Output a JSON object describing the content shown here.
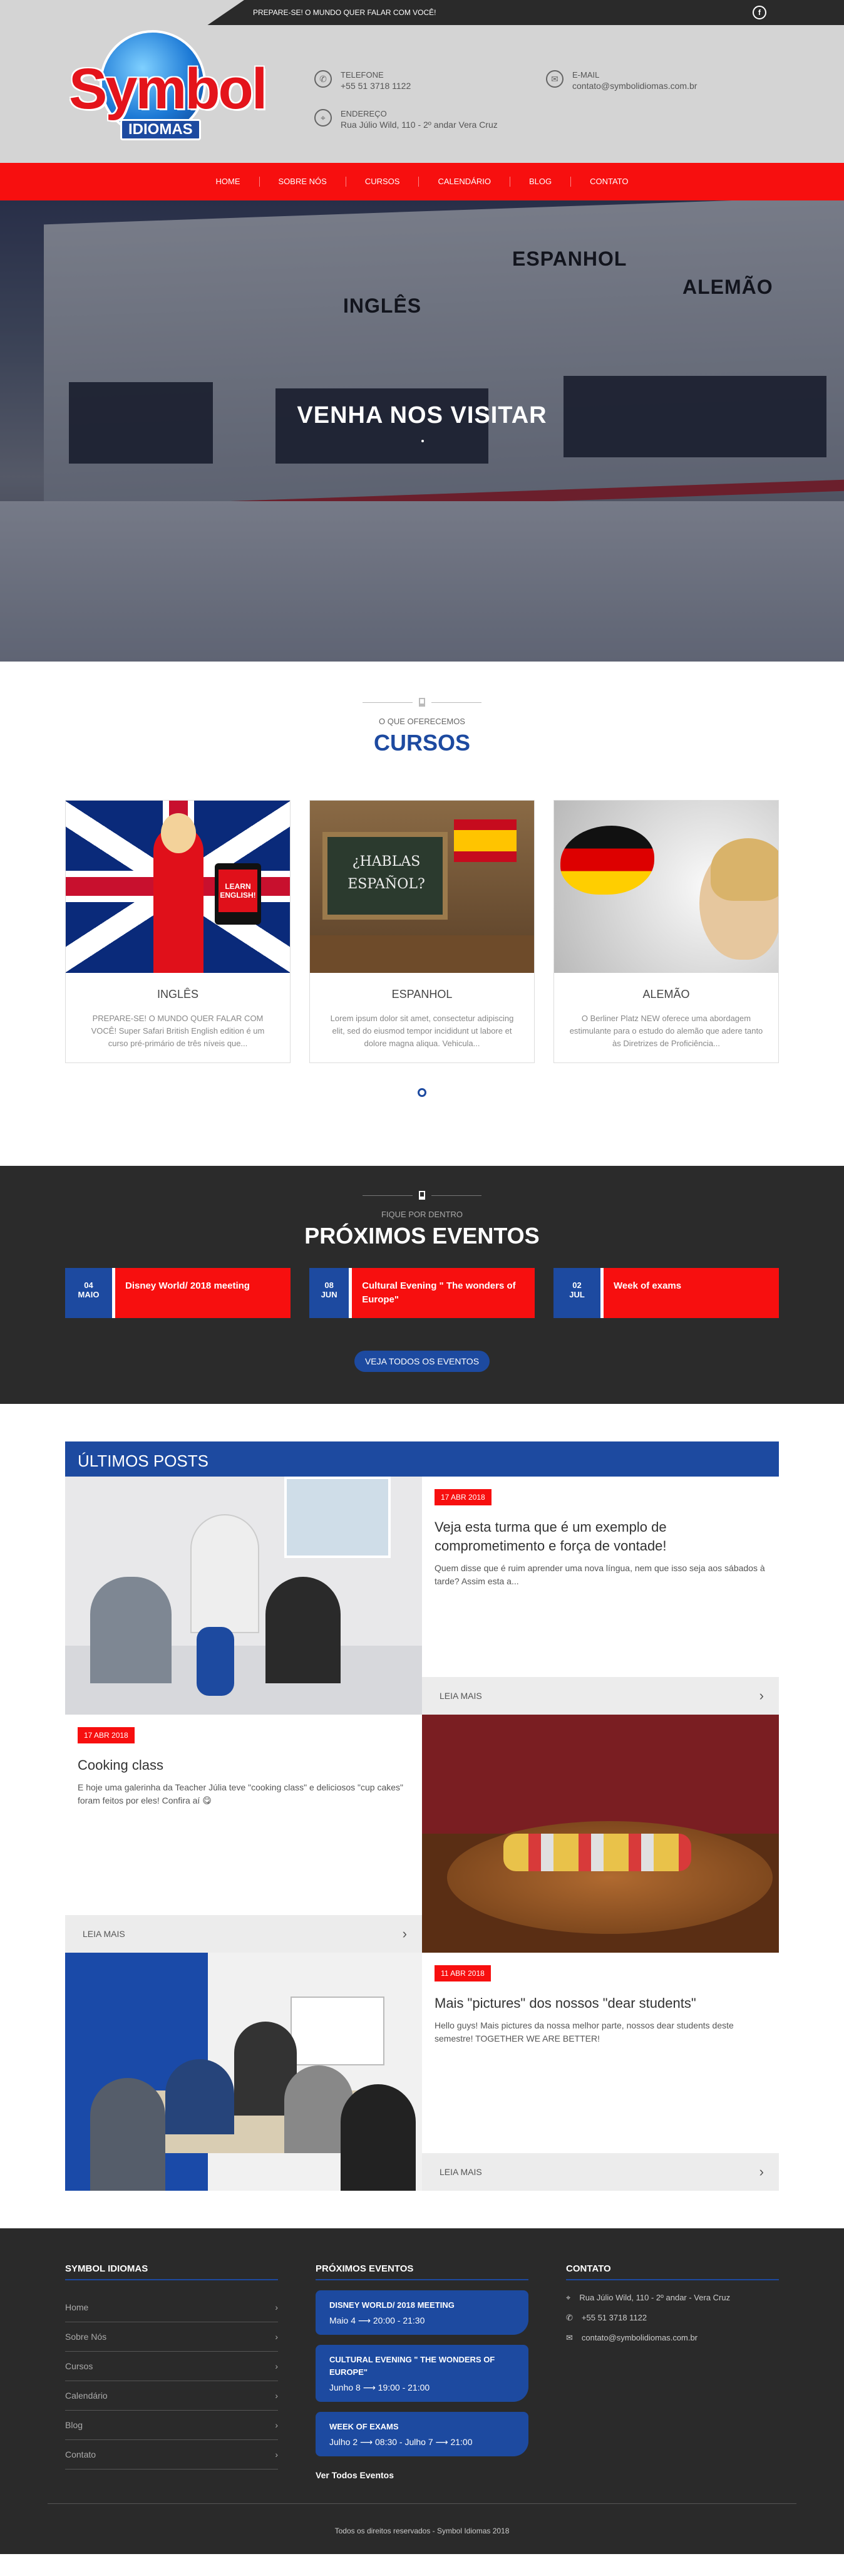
{
  "topbar": {
    "slogan": "PREPARE-SE! O MUNDO QUER FALAR COM VOCÊ!",
    "facebook_icon": "f"
  },
  "logo": {
    "brand": "Symbol",
    "sub": "IDIOMAS"
  },
  "header": {
    "phone_label": "TELEFONE",
    "phone": "+55 51 3718 1122",
    "address_label": "ENDEREÇO",
    "address": "Rua Júlio Wild, 110 - 2º andar Vera Cruz",
    "email_label": "E-MAIL",
    "email": "contato@symbolidiomas.com.br"
  },
  "nav": [
    "HOME",
    "SOBRE NÓS",
    "CURSOS",
    "CALENDÁRIO",
    "BLOG",
    "CONTATO"
  ],
  "hero": {
    "title": "VENHA NOS VISITAR",
    "signs": [
      "ESPANHOL",
      "INGLÊS",
      "ALEMÃO"
    ]
  },
  "cursos": {
    "mini": "O QUE OFERECEMOS",
    "title": "CURSOS",
    "items": [
      {
        "title": "INGLÊS",
        "text": "PREPARE-SE! O MUNDO QUER FALAR COM VOCÊ! Super Safari British English edition é um curso pré-primário de três níveis que...",
        "badge": "LEARN ENGLISH!"
      },
      {
        "title": "ESPANHOL",
        "text": "Lorem ipsum dolor sit amet, consectetur adipiscing elit, sed do eiusmod tempor incididunt ut labore et dolore magna aliqua. Vehicula...",
        "badge": "¿HABLAS ESPAÑOL?"
      },
      {
        "title": "ALEMÃO",
        "text": "O Berliner Platz NEW oferece uma abordagem estimulante para o estudo do alemão que adere tanto às Diretrizes de Proficiência..."
      }
    ]
  },
  "eventos": {
    "mini": "FIQUE POR DENTRO",
    "title": "PRÓXIMOS EVENTOS",
    "items": [
      {
        "day": "04",
        "month": "MAIO",
        "name": "Disney World/ 2018 meeting"
      },
      {
        "day": "08",
        "month": "JUN",
        "name": "Cultural Evening \" The wonders of Europe\""
      },
      {
        "day": "02",
        "month": "JUL",
        "name": "Week of exams"
      }
    ],
    "button": "VEJA TODOS OS EVENTOS"
  },
  "posts": {
    "title": "ÚLTIMOS POSTS",
    "items": [
      {
        "date": "17 ABR 2018",
        "title": "Veja esta turma que é um exemplo de comprometimento e força de vontade!",
        "text": "Quem disse que é ruim aprender uma nova língua, nem que isso seja aos sábados à tarde? Assim esta a...",
        "more": "LEIA MAIS"
      },
      {
        "date": "17 ABR 2018",
        "title": "Cooking class",
        "text": "E hoje uma galerinha da Teacher Júlia teve \"cooking class\" e deliciosos \"cup cakes\" foram feitos por eles! Confira aí 😋",
        "more": "LEIA MAIS"
      },
      {
        "date": "11 ABR 2018",
        "title": "Mais \"pictures\" dos nossos \"dear students\"",
        "text": "Hello guys! Mais pictures da nossa melhor parte, nossos dear students deste semestre! TOGETHER WE ARE BETTER!",
        "more": "LEIA MAIS"
      }
    ]
  },
  "footer": {
    "col1_title": "SYMBOL IDIOMAS",
    "links": [
      "Home",
      "Sobre Nós",
      "Cursos",
      "Calendário",
      "Blog",
      "Contato"
    ],
    "col2_title": "PRÓXIMOS EVENTOS",
    "events": [
      {
        "title": "DISNEY WORLD/ 2018 MEETING",
        "when": "Maio 4 ⟶ 20:00 - 21:30"
      },
      {
        "title": "CULTURAL EVENING \" THE WONDERS OF EUROPE\"",
        "when": "Junho 8 ⟶ 19:00 - 21:00"
      },
      {
        "title": "WEEK OF EXAMS",
        "when": "Julho 2 ⟶ 08:30 - Julho 7 ⟶ 21:00"
      }
    ],
    "all_events": "Ver Todos Eventos",
    "col3_title": "CONTATO",
    "contact": {
      "address": "Rua Júlio Wild, 110 - 2º andar - Vera Cruz",
      "phone": "+55 51 3718 1122",
      "email": "contato@symbolidiomas.com.br"
    },
    "copyright": "Todos os direitos reservados - Symbol Idiomas 2018"
  },
  "colors": {
    "red": "#f70f0f",
    "blue": "#1d4aa0",
    "dark": "#2a2a2a"
  }
}
